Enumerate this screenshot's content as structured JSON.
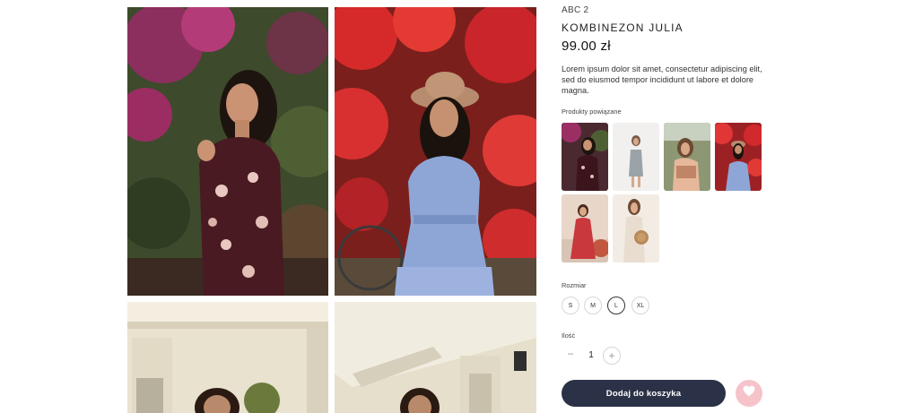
{
  "product": {
    "brand": "ABC 2",
    "name": "KOMBINEZON JULIA",
    "price": "99.00 zł",
    "description": "Lorem ipsum dolor sit amet, consectetur adipiscing elit, sed do eiusmod tempor incididunt ut labore et dolore magna."
  },
  "gallery": {
    "photos": [
      {
        "alt": "photo-floral-romper"
      },
      {
        "alt": "photo-blue-dress"
      },
      {
        "alt": "photo-house-1"
      },
      {
        "alt": "photo-house-2"
      }
    ]
  },
  "related": {
    "label": "Produkty powiązane",
    "count": 6
  },
  "size": {
    "label": "Rozmiar",
    "options": [
      "S",
      "M",
      "L",
      "XL"
    ],
    "selected": "L"
  },
  "quantity": {
    "label": "Ilość",
    "value": "1",
    "minus": "−",
    "plus": "+"
  },
  "actions": {
    "add_to_cart": "Dodaj do koszyka"
  },
  "colors": {
    "primary": "#2b3247",
    "wishlist": "#f6c3cb",
    "wishlist_icon": "#ffffff"
  },
  "icons": {
    "wishlist": "heart-icon"
  }
}
